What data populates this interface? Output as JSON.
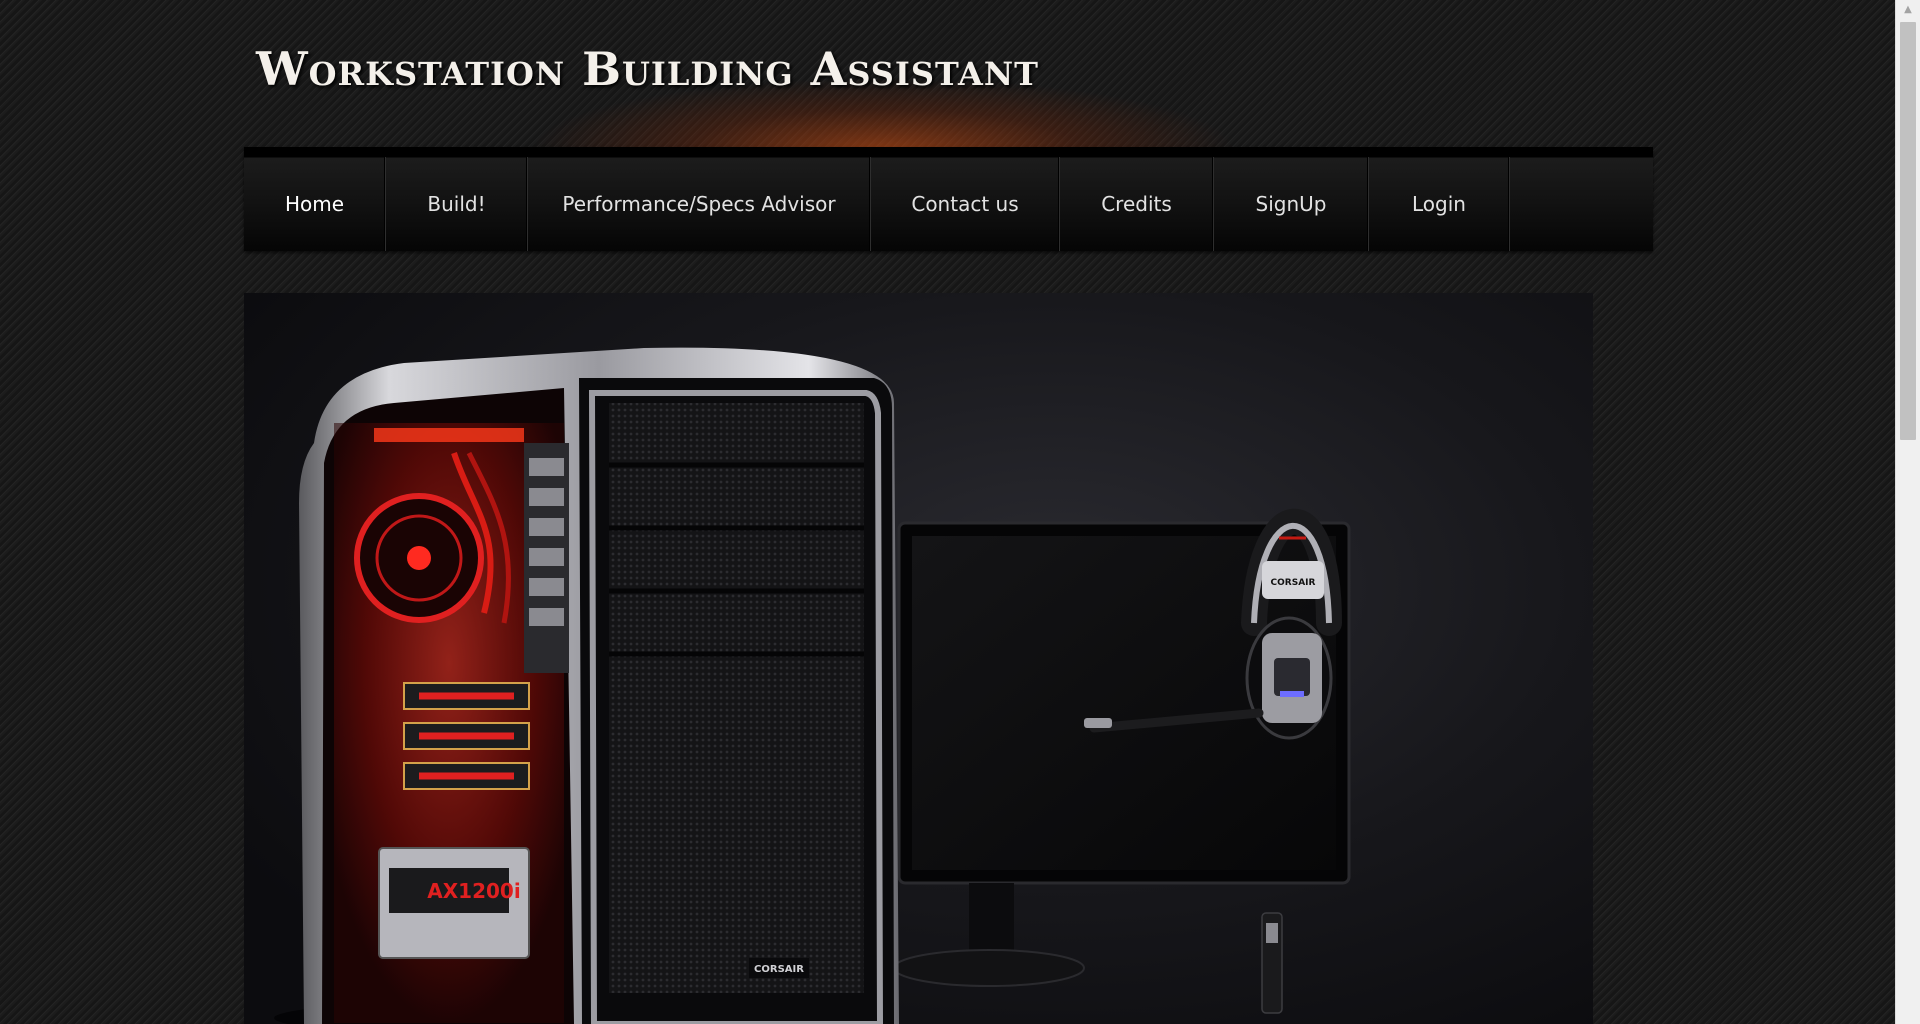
{
  "header": {
    "title": "Workstation Building Assistant"
  },
  "nav": {
    "items": [
      {
        "label": "Home",
        "active": true
      },
      {
        "label": "Build!",
        "active": false
      },
      {
        "label": "Performance/Specs Advisor",
        "active": false
      },
      {
        "label": "Contact us",
        "active": false
      },
      {
        "label": "Credits",
        "active": false
      },
      {
        "label": "SignUp",
        "active": false
      },
      {
        "label": "Login",
        "active": false
      }
    ]
  },
  "hero": {
    "image_subject": "computer-case-monitor-headset-photo",
    "brand_text": "CORSAIR",
    "psu_label": "AX1200i"
  },
  "scrollbar": {
    "up_arrow_icon": "triangle-up-icon"
  },
  "colors": {
    "background": "#1b1b1b",
    "header_glow": "#ba4812",
    "nav_background": "#0a0a0a",
    "nav_text": "#e2e2e2",
    "title_text": "#f4f0ea",
    "case_accent_red": "#d01818"
  }
}
